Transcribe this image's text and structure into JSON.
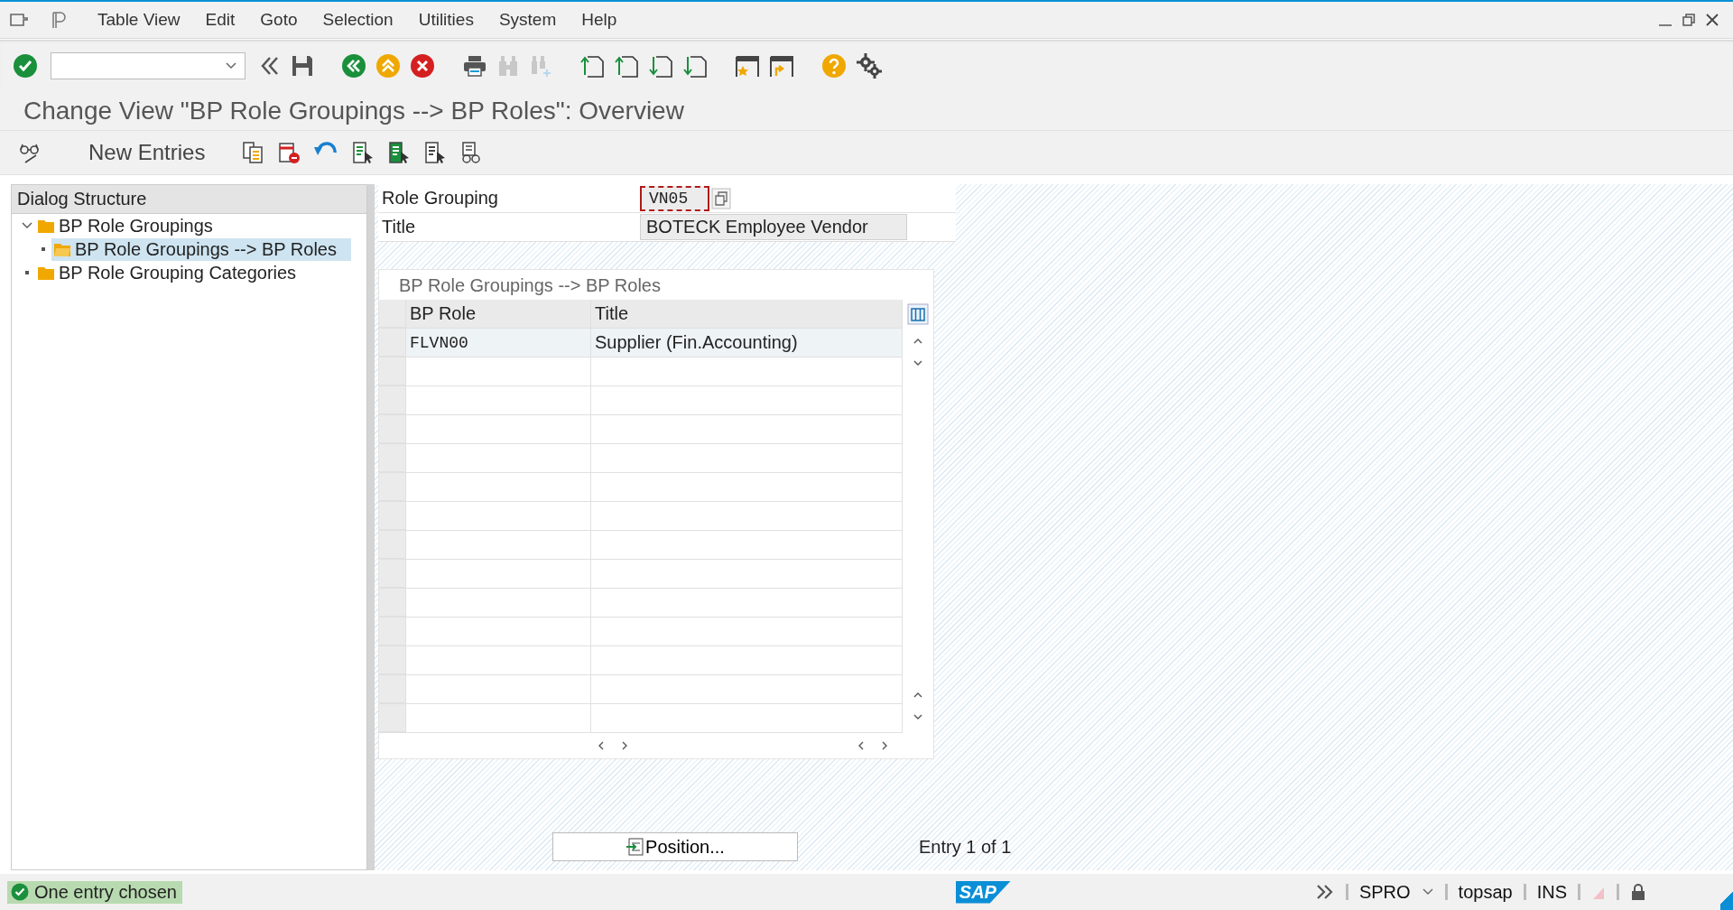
{
  "menu": [
    "Table View",
    "Edit",
    "Goto",
    "Selection",
    "Utilities",
    "System",
    "Help"
  ],
  "title": "Change View \"BP Role Groupings --> BP Roles\": Overview",
  "app_toolbar": {
    "new_entries": "New Entries"
  },
  "dialog_structure": {
    "heading": "Dialog Structure",
    "items": [
      {
        "label": "BP Role Groupings",
        "selected": false,
        "children": [
          {
            "label": "BP Role Groupings --> BP Roles",
            "selected": true
          }
        ]
      },
      {
        "label": "BP Role Grouping Categories",
        "selected": false
      }
    ]
  },
  "fields": [
    {
      "label": "Role Grouping",
      "value": "VN05",
      "kind": "key"
    },
    {
      "label": "Title",
      "value": "BOTECK Employee Vendor",
      "kind": "text"
    }
  ],
  "table": {
    "caption": "BP Role Groupings --> BP Roles",
    "columns": [
      "BP Role",
      "Title"
    ],
    "rows": [
      [
        "FLVN00",
        "Supplier (Fin.Accounting)"
      ]
    ]
  },
  "position_button": "Position...",
  "entry_info": "Entry 1 of 1",
  "status_bar": {
    "message": "One entry chosen",
    "kind": "success",
    "logo": "SAP",
    "transaction": "SPRO",
    "system": "topsap",
    "mode": "INS"
  }
}
